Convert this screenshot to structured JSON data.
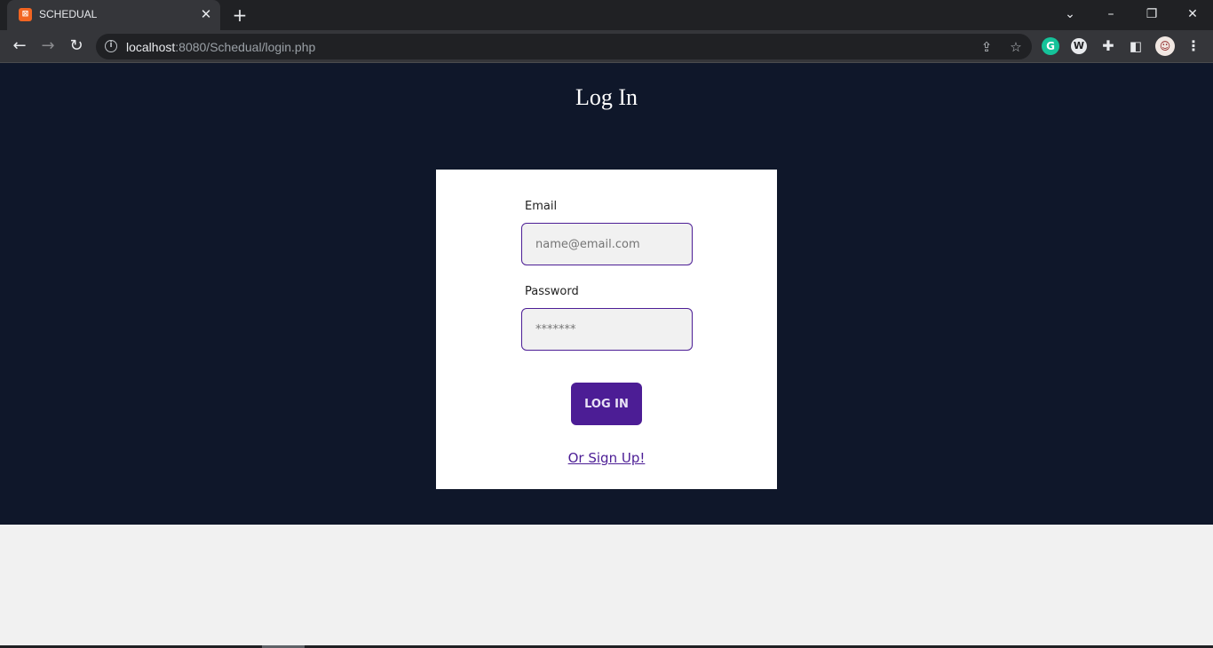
{
  "browser": {
    "tab": {
      "title": "SCHEDUAL",
      "favicon": "xampp-icon"
    },
    "url": {
      "host": "localhost",
      "rest": ":8080/Schedual/login.php"
    }
  },
  "page": {
    "heading": "Log In",
    "email": {
      "label": "Email",
      "placeholder": "name@email.com",
      "value": ""
    },
    "password": {
      "label": "Password",
      "placeholder": "*******",
      "value": ""
    },
    "login_button": "LOG IN",
    "signup_link": "Or Sign Up!"
  },
  "colors": {
    "page_bg": "#0f172a",
    "card_bg": "#ffffff",
    "accent": "#4c1d95",
    "input_bg": "#f1f1f1"
  }
}
